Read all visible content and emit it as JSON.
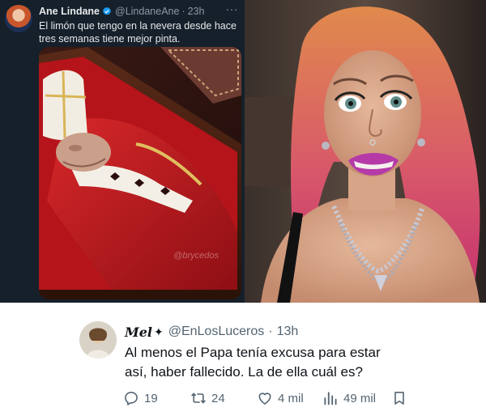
{
  "quoted_tweet": {
    "author_name": "Ane Lindane",
    "handle": "@LindaneAne",
    "separator": "·",
    "time": "23h",
    "more": "···",
    "text": "El limón que tengo en la nevera desde hace tres semanas tiene mejor pinta.",
    "media_watermark": "@brycedos"
  },
  "reply": {
    "author_name": "Mel",
    "star": "✦",
    "handle": "@EnLosLuceros",
    "separator": "·",
    "time": "13h",
    "text": "Al menos el Papa tenía excusa para estar así, haber fallecido. La de ella cuál es?",
    "actions": {
      "replies": "19",
      "retweets": "24",
      "likes": "4 mil",
      "views": "49 mil"
    }
  },
  "colors": {
    "dark_bg": "#15202b",
    "light_bg": "#ffffff",
    "verified_blue": "#1d9bf0",
    "muted_text": "#536471"
  },
  "icons": [
    "verified-badge-icon",
    "more-icon",
    "reply-icon",
    "retweet-icon",
    "like-icon",
    "views-icon",
    "bookmark-icon"
  ]
}
